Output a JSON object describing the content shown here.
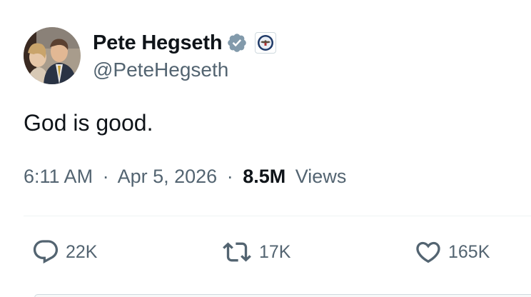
{
  "author": {
    "display_name": "Pete Hegseth",
    "handle": "@PeteHegseth",
    "verified_icon": "verified-badge-icon",
    "affiliation_icon": "department-seal-icon"
  },
  "tweet": {
    "text": "God is good."
  },
  "meta": {
    "time": "6:11 AM",
    "separator": "·",
    "date": "Apr 5, 2026",
    "views_count": "8.5M",
    "views_label": "Views"
  },
  "actions": {
    "reply": {
      "icon": "reply-icon",
      "count": "22K"
    },
    "retweet": {
      "icon": "retweet-icon",
      "count": "17K"
    },
    "like": {
      "icon": "heart-icon",
      "count": "165K"
    }
  },
  "colors": {
    "text_primary": "#0f1419",
    "text_secondary": "#536471",
    "verified": "#829aab",
    "divider": "#eff3f4"
  }
}
